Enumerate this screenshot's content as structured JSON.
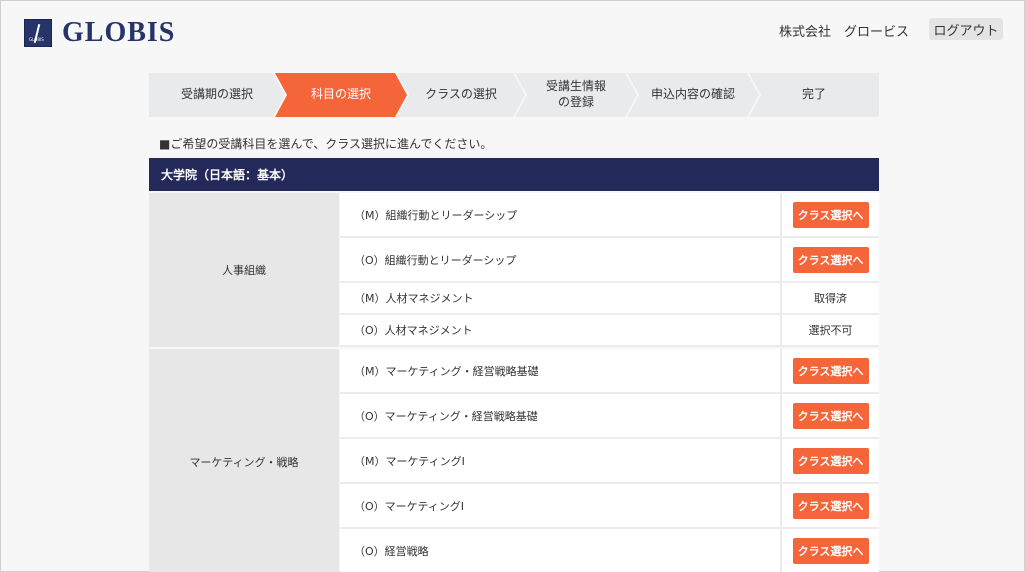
{
  "header": {
    "logo_text": "GLOBIS",
    "logo_mark_text": "GLOBIS",
    "company": "株式会社　グロービス",
    "logout_label": "ログアウト"
  },
  "steps": [
    {
      "label": "受講期の選択",
      "active": false
    },
    {
      "label": "科目の選択",
      "active": true
    },
    {
      "label": "クラスの選択",
      "active": false
    },
    {
      "label": "受講生情報\nの登録",
      "line1": "受講生情報",
      "line2": "の登録",
      "active": false
    },
    {
      "label": "申込内容の確認",
      "active": false
    },
    {
      "label": "完了",
      "active": false
    }
  ],
  "instruction": "■ご希望の受講科目を選んで、クラス選択に進んでください。",
  "section_title": "大学院（日本語：基本）",
  "groups": [
    {
      "name": "人事組織",
      "rows": [
        {
          "course": "（M）組織行動とリーダーシップ",
          "action": "クラス選択へ",
          "type": "button"
        },
        {
          "course": "（O）組織行動とリーダーシップ",
          "action": "クラス選択へ",
          "type": "button"
        },
        {
          "course": "（M）人材マネジメント",
          "action": "取得済",
          "type": "text"
        },
        {
          "course": "（O）人材マネジメント",
          "action": "選択不可",
          "type": "text"
        }
      ]
    },
    {
      "name": "マーケティング・戦略",
      "rows": [
        {
          "course": "（M）マーケティング・経営戦略基礎",
          "action": "クラス選択へ",
          "type": "button"
        },
        {
          "course": "（O）マーケティング・経営戦略基礎",
          "action": "クラス選択へ",
          "type": "button"
        },
        {
          "course": "（M）マーケティングI",
          "action": "クラス選択へ",
          "type": "button"
        },
        {
          "course": "（O）マーケティングI",
          "action": "クラス選択へ",
          "type": "button"
        },
        {
          "course": "（O）経営戦略",
          "action": "クラス選択へ",
          "type": "button"
        }
      ]
    }
  ]
}
